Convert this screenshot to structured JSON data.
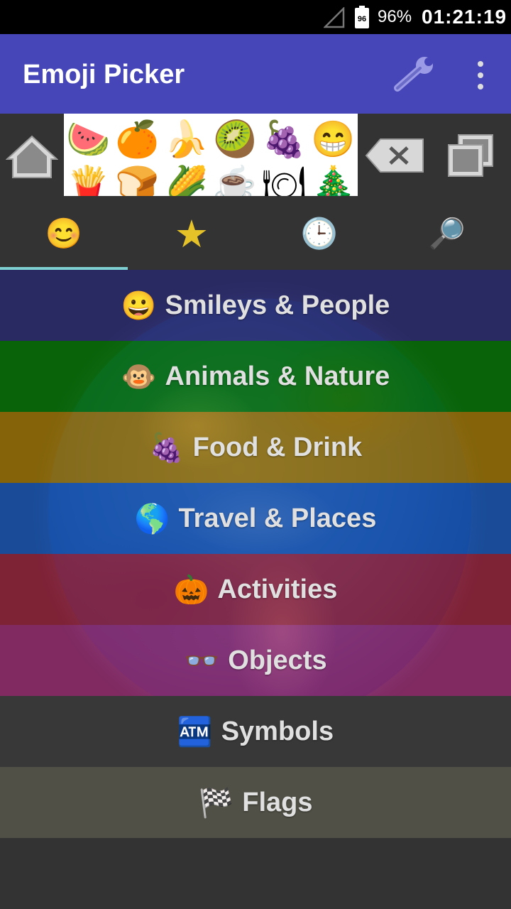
{
  "status_bar": {
    "battery_percent": "96%",
    "battery_icon_label": "96",
    "time": "01:21:19"
  },
  "app_bar": {
    "title": "Emoji Picker",
    "icons": [
      "wrench-icon",
      "overflow-menu-icon"
    ]
  },
  "toolbar": {
    "icons": [
      "home-icon",
      "backspace-icon",
      "copy-icon"
    ],
    "ad_emojis_row1": [
      "🍉",
      "🍊",
      "🍌",
      "🥝",
      "🍇",
      "😁"
    ],
    "ad_emojis_row2": [
      "🍟",
      "🍞",
      "🌽",
      "☕",
      "🍽",
      "🎄"
    ]
  },
  "tabs": [
    {
      "glyph": "😊",
      "icon": "smiley-tab-icon",
      "selected": true
    },
    {
      "glyph": "★",
      "icon": "star-tab-icon",
      "selected": false
    },
    {
      "glyph": "🕒",
      "icon": "clock-tab-icon",
      "selected": false
    },
    {
      "glyph": "🔎",
      "icon": "search-tab-icon",
      "selected": false
    }
  ],
  "categories": [
    {
      "emoji": "😀",
      "label": "Smileys & People"
    },
    {
      "emoji": "🐵",
      "label": "Animals & Nature"
    },
    {
      "emoji": "🍇",
      "label": "Food & Drink"
    },
    {
      "emoji": "🌎",
      "label": "Travel & Places"
    },
    {
      "emoji": "🎃",
      "label": "Activities"
    },
    {
      "emoji": "👓",
      "label": "Objects"
    },
    {
      "emoji": "🏧",
      "label": "Symbols"
    },
    {
      "emoji": "🏁",
      "label": "Flags"
    }
  ],
  "colors": {
    "app_bar": "#4646b8",
    "background": "#333333",
    "tab_indicator": "#7fd0d0"
  }
}
